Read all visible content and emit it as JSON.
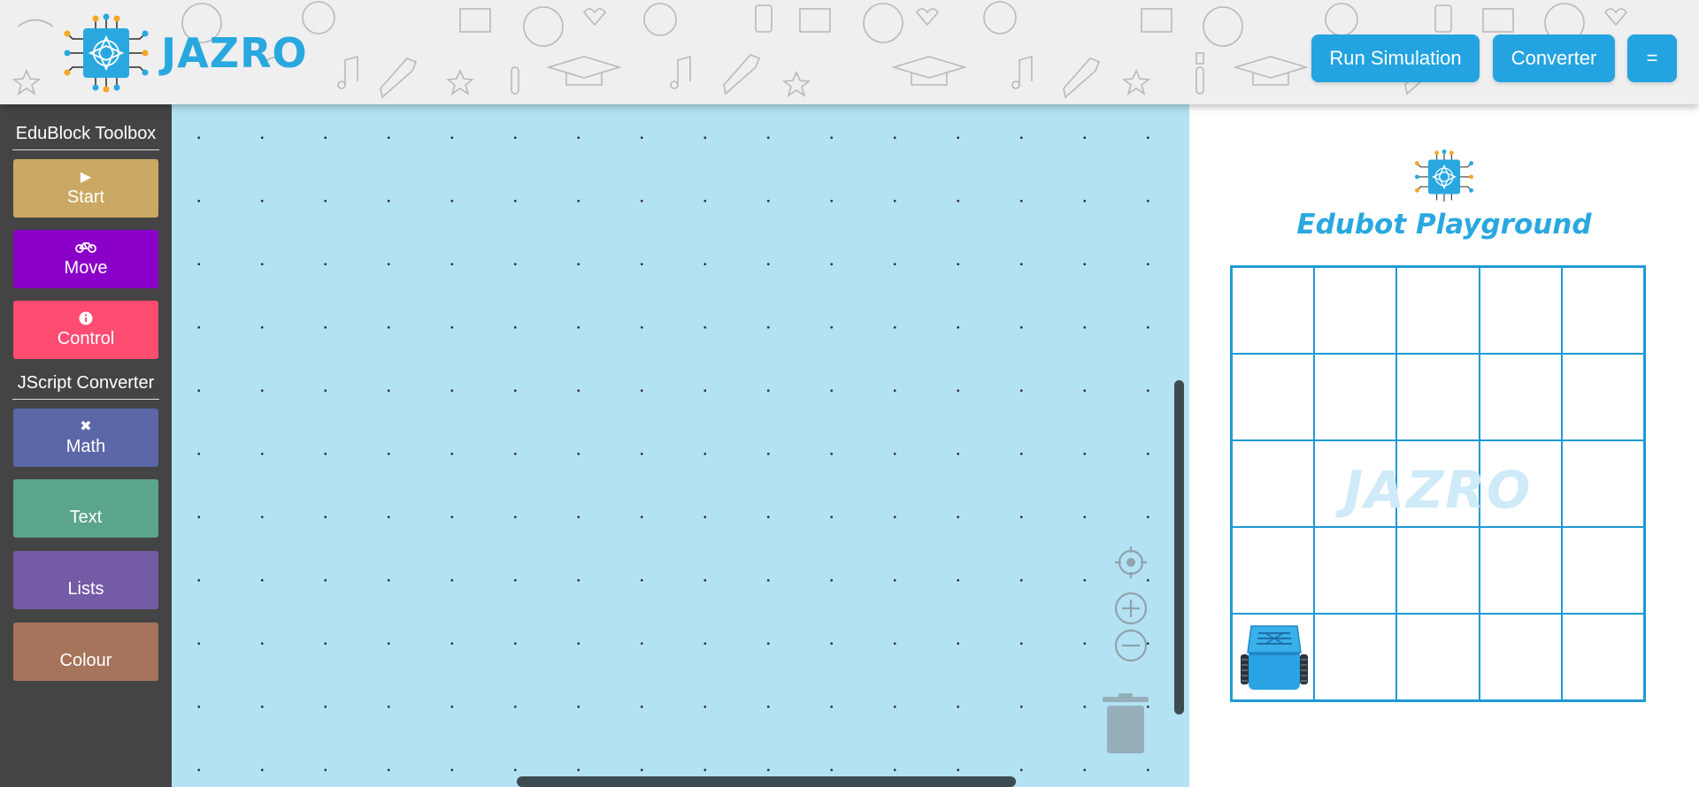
{
  "header": {
    "logo_text": "JAZRO",
    "buttons": [
      {
        "label": "Run Simulation"
      },
      {
        "label": "Converter"
      },
      {
        "label": "="
      }
    ]
  },
  "toolbox": {
    "heading_edublock": "EduBlock Toolbox",
    "heading_jscript": "JScript Converter",
    "items": [
      {
        "label": "Start",
        "icon": "play-icon",
        "color": "#cba863"
      },
      {
        "label": "Move",
        "icon": "bicycle-icon",
        "color": "#8a00c8"
      },
      {
        "label": "Control",
        "icon": "info-icon",
        "color": "#ff4c71"
      },
      {
        "label": "Math",
        "icon": "times-icon",
        "color": "#5b67a6"
      },
      {
        "label": "Text",
        "icon": "",
        "color": "#5ba58b"
      },
      {
        "label": "Lists",
        "icon": "",
        "color": "#745ba5"
      },
      {
        "label": "Colour",
        "icon": "",
        "color": "#a5745b"
      }
    ]
  },
  "playground": {
    "title": "Edubot Playground",
    "watermark": "JAZRO",
    "grid_rows": 5,
    "grid_cols": 5,
    "robot_cell": {
      "row": 5,
      "col": 1
    }
  },
  "colors": {
    "brand_blue": "#29a8e0",
    "workspace_bg": "#b3e2f3",
    "toolbox_bg": "#444444"
  }
}
